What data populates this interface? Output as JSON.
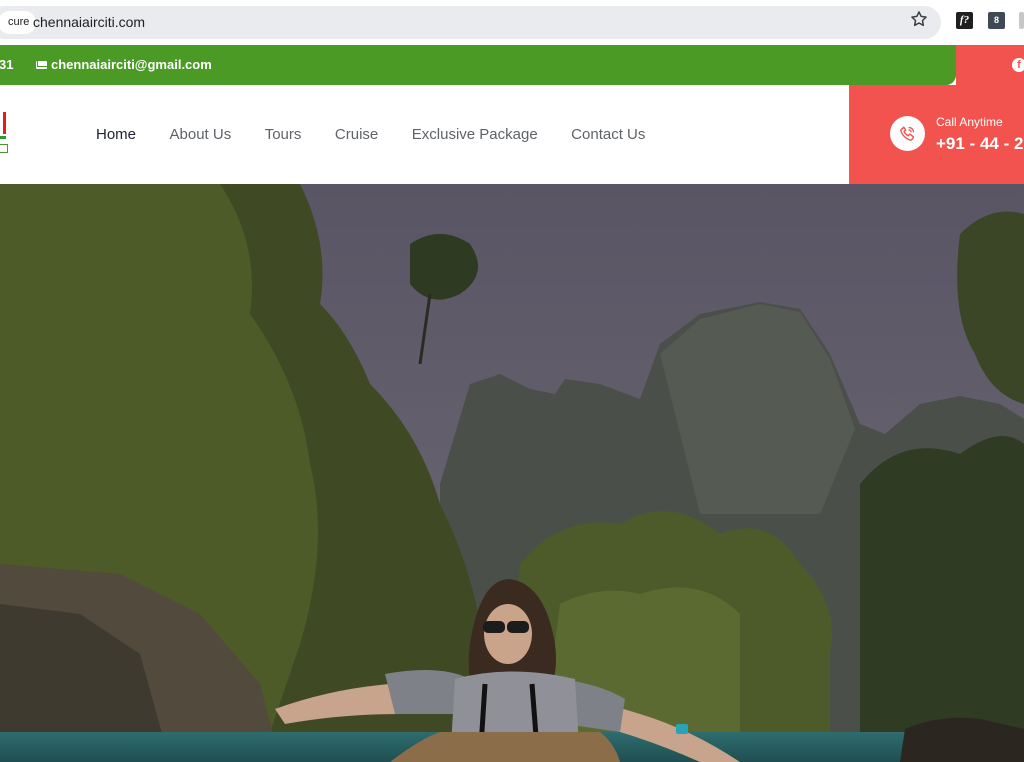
{
  "browser": {
    "secure_label": "cure",
    "url": "chennaiairciti.com",
    "ext_fq": "f?",
    "ext_book": "8"
  },
  "topbar": {
    "phone_fragment": "31",
    "email": "chennaiairciti@gmail.com",
    "facebook_icon": "f"
  },
  "nav": {
    "items": [
      "Home",
      "About Us",
      "Tours",
      "Cruise",
      "Exclusive Package",
      "Contact Us"
    ],
    "active": "Home"
  },
  "call": {
    "label": "Call Anytime",
    "number": "+91 - 44 - 2"
  },
  "colors": {
    "green": "#4a9a25",
    "coral": "#f3534f",
    "nav_text": "#5f6368",
    "nav_active": "#1e2230"
  }
}
